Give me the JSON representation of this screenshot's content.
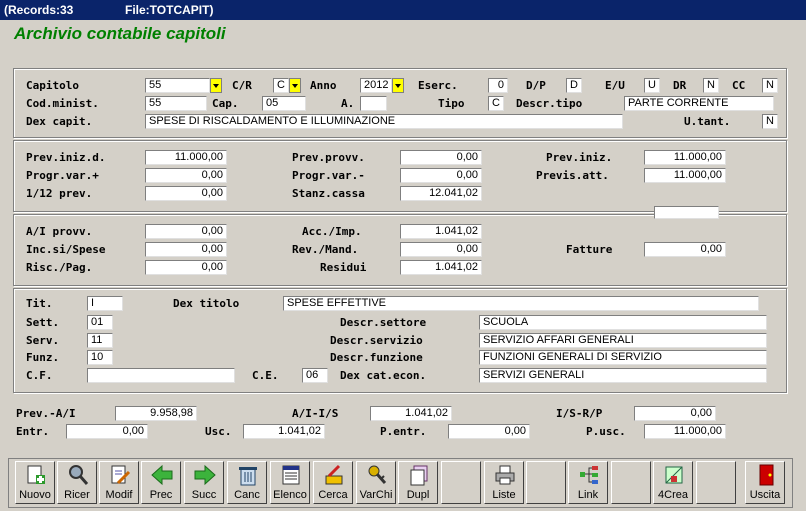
{
  "window": {
    "records": "(Records:33",
    "file": "File:TOTCAPIT)"
  },
  "form_title": "Archivio contabile capitoli",
  "sec1": {
    "capitolo_label": "Capitolo",
    "capitolo": "55",
    "cr_label": "C/R",
    "cr": "C",
    "anno_label": "Anno",
    "anno": "2012",
    "eserc_label": "Eserc.",
    "eserc": "0",
    "dp_label": "D/P",
    "dp": "D",
    "eu_label": "E/U",
    "eu": "U",
    "dr_label": "DR",
    "dr": "N",
    "cc_label": "CC",
    "cc": "N",
    "codminist_label": "Cod.minist.",
    "codminist": "55",
    "cap_label": "Cap.",
    "cap": "05",
    "a_label": "A.",
    "a": "",
    "tipo_label": "Tipo",
    "tipo": "C",
    "descrtipo_label": "Descr.tipo",
    "descrtipo": "PARTE CORRENTE",
    "dexcapit_label": "Dex capit.",
    "dexcapit": "SPESE DI RISCALDAMENTO E ILLUMINAZIONE",
    "utant_label": "U.tant.",
    "utant": "N"
  },
  "sec2": {
    "previnizd_label": "Prev.iniz.d.",
    "previnizd": "11.000,00",
    "progrvarp_label": "Progr.var.+",
    "progrvarp": "0,00",
    "dodicesimo_label": "1/12 prev.",
    "dodicesimo": "0,00",
    "prevprovv_label": "Prev.provv.",
    "prevprovv": "0,00",
    "progrvarm_label": "Progr.var.-",
    "progrvarm": "0,00",
    "stanzcassa_label": "Stanz.cassa",
    "stanzcassa": "12.041,02",
    "previniz_label": "Prev.iniz.",
    "previniz": "11.000,00",
    "previsatt_label": "Previs.att.",
    "previsatt": "11.000,00",
    "extra": ""
  },
  "sec3": {
    "aiprovv_label": "A/I provv.",
    "aiprovv": "0,00",
    "incsi_label": "Inc.si/Spese",
    "incsi": "0,00",
    "risc_label": "Risc./Pag.",
    "risc": "0,00",
    "accimp_label": "Acc./Imp.",
    "accimp": "1.041,02",
    "revmand_label": "Rev./Mand.",
    "revmand": "0,00",
    "residui_label": "Residui",
    "residui": "1.041,02",
    "fatture_label": "Fatture",
    "fatture": "0,00"
  },
  "sec4": {
    "tit_label": "Tit.",
    "tit": "I",
    "dextitolo_label": "Dex titolo",
    "dextitolo": "SPESE EFFETTIVE",
    "sett_label": "Sett.",
    "sett": "01",
    "descrsettore_label": "Descr.settore",
    "descrsettore": "SCUOLA",
    "serv_label": "Serv.",
    "serv": "11",
    "descrservizio_label": "Descr.servizio",
    "descrservizio": "SERVIZIO AFFARI GENERALI",
    "funz_label": "Funz.",
    "funz": "10",
    "descrfunzione_label": "Descr.funzione",
    "descrfunzione": "FUNZIONI GENERALI DI SERVIZIO",
    "cf_label": "C.F.",
    "cf": "",
    "ce_label": "C.E.",
    "ce": "06",
    "dexcatecon_label": "Dex cat.econ.",
    "dexcatecon": "SERVIZI GENERALI"
  },
  "totals": {
    "preva_label": "Prev.-A/I",
    "preva": "9.958,98",
    "ais_label": "A/I-I/S",
    "ais": "1.041,02",
    "isrp_label": "I/S-R/P",
    "isrp": "0,00",
    "entr_label": "Entr.",
    "entr": "0,00",
    "usc_label": "Usc.",
    "usc": "1.041,02",
    "pentr_label": "P.entr.",
    "pentr": "0,00",
    "pusc_label": "P.usc.",
    "pusc": "11.000,00"
  },
  "toolbar": {
    "nuovo": "Nuovo",
    "ricer": "Ricer",
    "modif": "Modif",
    "prec": "Prec",
    "succ": "Succ",
    "canc": "Canc",
    "elenco": "Elenco",
    "cerca": "Cerca",
    "varchi": "VarChi",
    "dupl": "Dupl",
    "liste": "Liste",
    "link": "Link",
    "crea": "4Crea",
    "uscita": "Uscita"
  },
  "icons": [
    "new-document-icon",
    "search-magnifier-icon",
    "edit-document-icon",
    "arrow-left-icon",
    "arrow-right-icon",
    "trash-icon",
    "list-icon",
    "search-paint-icon",
    "keys-icon",
    "duplicate-icon",
    "printer-icon",
    "link-tree-icon",
    "create-icon",
    "exit-door-icon"
  ],
  "colors": {
    "title_bar": "#0a246a",
    "form_title": "#008000",
    "dropdown": "#ffff00",
    "background": "#d4d0c8"
  }
}
